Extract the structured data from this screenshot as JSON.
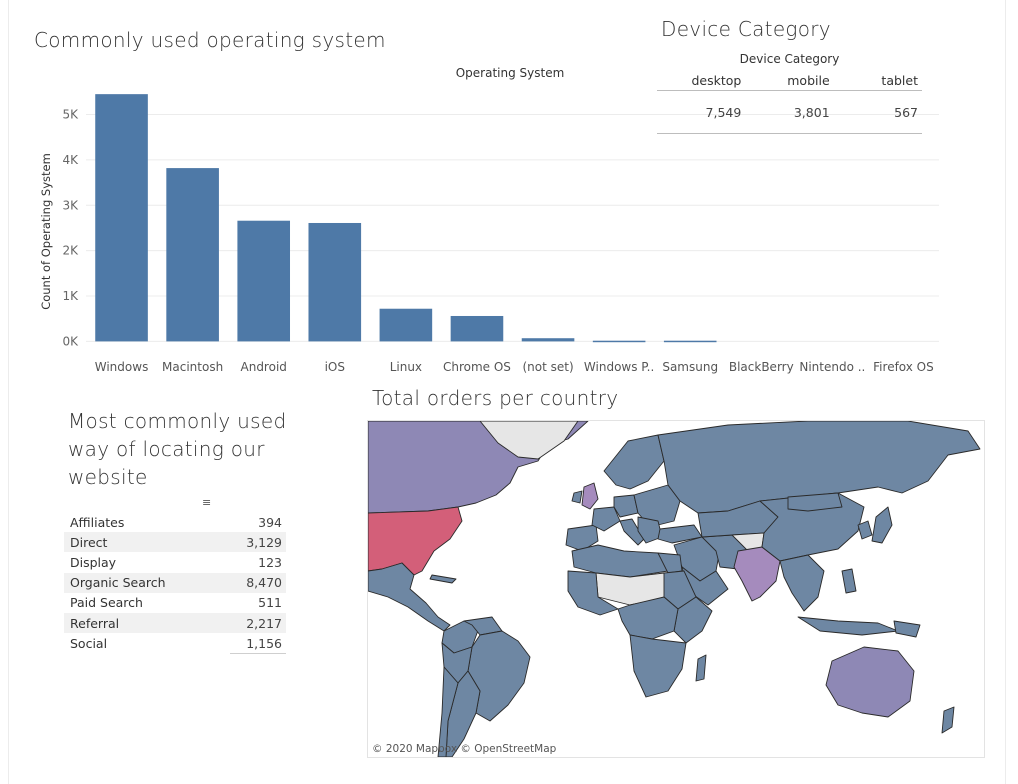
{
  "titles": {
    "os": "Commonly used operating system",
    "device": "Device Category",
    "channel": "Most commonly used way of locating our website",
    "map": "Total orders per country"
  },
  "chart_data": {
    "type": "bar",
    "title": "Commonly used operating system",
    "top_label": "Operating System",
    "ylabel": "Count of Operating System",
    "xlabel": "",
    "categories": [
      "Windows",
      "Macintosh",
      "Android",
      "iOS",
      "Linux",
      "Chrome OS",
      "(not set)",
      "Windows P..",
      "Samsung",
      "BlackBerry",
      "Nintendo ..",
      "Firefox OS"
    ],
    "values": [
      5450,
      3820,
      2660,
      2610,
      720,
      560,
      70,
      15,
      15,
      0,
      0,
      0
    ],
    "yticks": [
      0,
      1000,
      2000,
      3000,
      4000,
      5000
    ],
    "ytick_labels": [
      "0K",
      "1K",
      "2K",
      "3K",
      "4K",
      "5K"
    ],
    "ylim": [
      -300,
      5850
    ],
    "grid": true,
    "bar_color": "#4e79a7"
  },
  "device_table": {
    "header": "Device Category",
    "columns": [
      "desktop",
      "mobile",
      "tablet"
    ],
    "values": [
      "7,549",
      "3,801",
      "567"
    ]
  },
  "channel_table": {
    "rows": [
      {
        "label": "Affiliates",
        "value": "394"
      },
      {
        "label": "Direct",
        "value": "3,129"
      },
      {
        "label": "Display",
        "value": "123"
      },
      {
        "label": "Organic Search",
        "value": "8,470"
      },
      {
        "label": "Paid Search",
        "value": "511"
      },
      {
        "label": "Referral",
        "value": "2,217"
      },
      {
        "label": "Social",
        "value": "1,156"
      }
    ]
  },
  "map": {
    "attribution": "© 2020 Mapbox © OpenStreetMap",
    "colors": {
      "land": "#6e87a3",
      "top": "#d35f79",
      "second": "#8e88b5",
      "third": "#a58bbd",
      "no_data": "#e6e6e6",
      "border": "#2a2a2a"
    }
  }
}
